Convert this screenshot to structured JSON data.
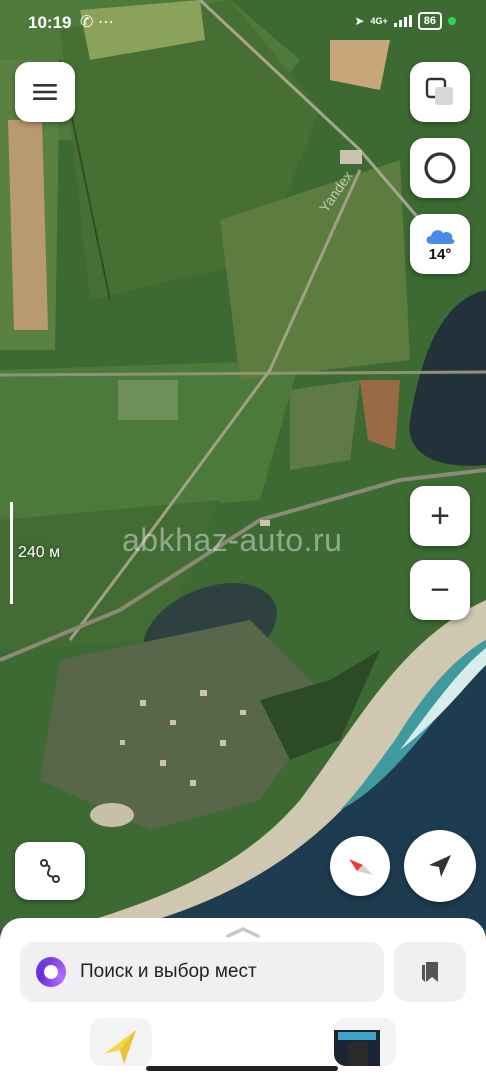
{
  "status_bar": {
    "time": "10:19",
    "network": "4G+",
    "battery": "86",
    "icons": [
      "whatsapp-icon",
      "more-dots-icon",
      "location-arrow-icon",
      "signal-icon"
    ]
  },
  "map": {
    "watermark": "abkhaz-auto.ru",
    "provider_label": "Yandex",
    "scale_label": "240 м",
    "weather": {
      "temperature": "14°",
      "icon": "cloud-icon"
    }
  },
  "controls": {
    "menu_icon": "hamburger-icon",
    "layers_icon": "layers-icon",
    "alice_icon": "alice-ring-icon",
    "zoom_in_label": "+",
    "zoom_out_label": "−",
    "route_icon": "route-icon",
    "compass_icon": "compass-icon",
    "locate_icon": "navigation-arrow-icon"
  },
  "bottom_sheet": {
    "search_placeholder": "Поиск и выбор мест",
    "bookmarks_icon": "bookmarks-icon"
  },
  "colors": {
    "accent_alice": "#7b3fe4",
    "compass_red": "#e8402f",
    "sheet_bg": "#ffffff",
    "search_bg": "#f0f0f2"
  }
}
